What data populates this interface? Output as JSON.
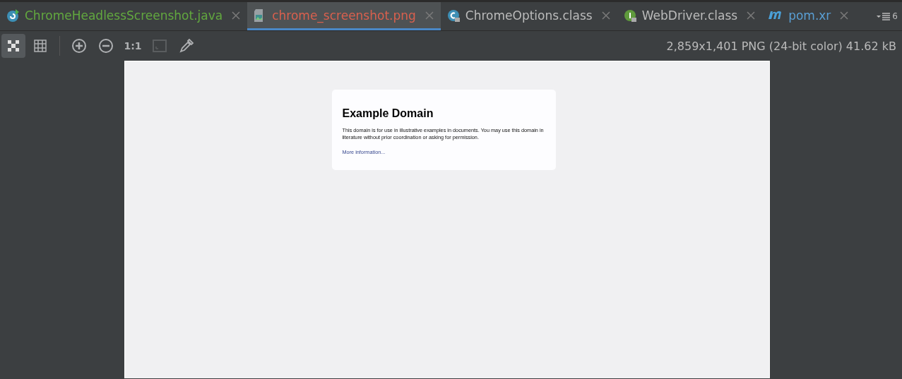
{
  "tabs": [
    {
      "label": "ChromeHeadlessScreenshot.java",
      "kind": "class-run",
      "color": "#62a83f",
      "selected": false,
      "locked": false
    },
    {
      "label": "chrome_screenshot.png",
      "kind": "image",
      "color": "#d9604e",
      "selected": true,
      "locked": false
    },
    {
      "label": "ChromeOptions.class",
      "kind": "class",
      "color": "#bbbbbb",
      "selected": false,
      "locked": true
    },
    {
      "label": "WebDriver.class",
      "kind": "interface",
      "color": "#bbbbbb",
      "selected": false,
      "locked": true
    },
    {
      "label": "pom.xr",
      "kind": "maven",
      "color": "#5a9fd4",
      "selected": false,
      "locked": false
    }
  ],
  "tab_overflow": {
    "count": "6"
  },
  "toolbar": {
    "items": [
      {
        "kind": "checker",
        "selected": true,
        "disabled": false
      },
      {
        "kind": "grid",
        "selected": false,
        "disabled": false
      },
      {
        "kind": "divider"
      },
      {
        "kind": "zoom-in",
        "selected": false,
        "disabled": false
      },
      {
        "kind": "zoom-out",
        "selected": false,
        "disabled": false
      },
      {
        "kind": "actual-size",
        "label": "1:1",
        "selected": false,
        "disabled": false
      },
      {
        "kind": "fit",
        "selected": false,
        "disabled": true
      },
      {
        "kind": "eyedropper",
        "selected": false,
        "disabled": false
      }
    ],
    "info": "2,859x1,401 PNG (24-bit color) 41.62 kB"
  },
  "preview": {
    "title": "Example Domain",
    "body": "This domain is for use in illustrative examples in documents. You may use this domain in literature without prior coordination or asking for permission.",
    "link": "More information..."
  }
}
